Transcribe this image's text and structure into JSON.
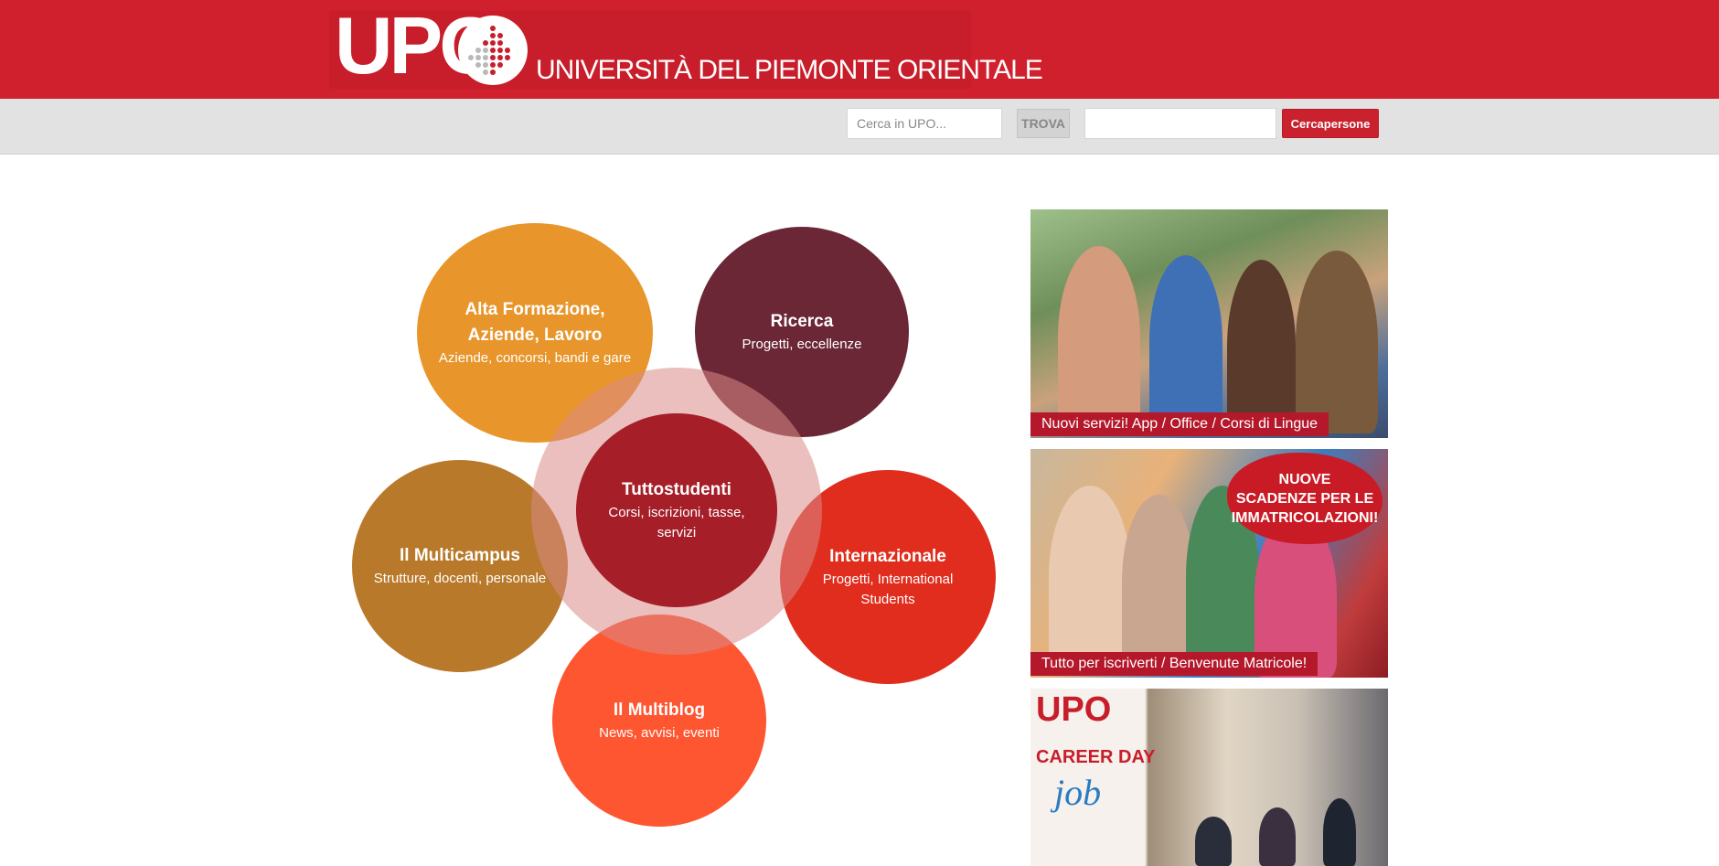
{
  "header": {
    "logo_upo": "UPO",
    "logo_text": "UNIVERSITÀ DEL PIEMONTE ORIENTALE"
  },
  "search": {
    "placeholder": "Cerca in UPO...",
    "button_label": "TROVA",
    "people_placeholder": "",
    "people_button_label": "Cercapersone"
  },
  "circles": {
    "alta": {
      "title": "Alta Formazione, Aziende, Lavoro",
      "subtitle": "Aziende, concorsi, bandi e gare",
      "color": "#e8962c"
    },
    "ricerca": {
      "title": "Ricerca",
      "subtitle": "Progetti, eccellenze",
      "color": "#6b2736"
    },
    "tuttostudenti": {
      "title": "Tuttostudenti",
      "subtitle": "Corsi, iscrizioni, tasse, servizi",
      "color": "#a51e28"
    },
    "multicampus": {
      "title": "Il Multicampus",
      "subtitle": "Strutture, docenti, personale",
      "color": "#b8792a"
    },
    "internazionale": {
      "title": "Internazionale",
      "subtitle": "Progetti, International Students",
      "color": "#e02d1d"
    },
    "multiblog": {
      "title": "Il Multiblog",
      "subtitle": "News, avvisi, eventi",
      "color": "#fe5631"
    }
  },
  "banners": [
    {
      "caption": "Nuovi servizi! App / Office / Corsi di Lingue"
    },
    {
      "caption": "Tutto per iscriverti / Benvenute Matricole!",
      "burst_line1": "NUOVE",
      "burst_line2": "SCADENZE PER LE",
      "burst_line3": "IMMATRICOLAZIONI!"
    },
    {
      "logo": "UPO",
      "headline": "CAREER DAY",
      "job": "job"
    }
  ],
  "colors": {
    "brand_red": "#d0202d",
    "search_bar": "#e2e2e2"
  }
}
